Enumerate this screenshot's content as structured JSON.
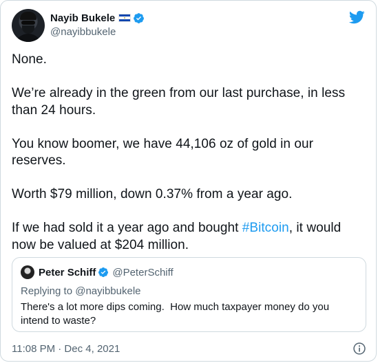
{
  "author": {
    "display_name": "Nayib Bukele",
    "handle": "@nayibbukele",
    "flag_icon": "el-salvador-flag-icon",
    "verified_icon": "verified-badge-icon"
  },
  "brand": {
    "logo_icon": "twitter-bird-icon",
    "accent_color": "#1d9bf0"
  },
  "tweet": {
    "p1": "None.",
    "p2": "We’re already in the green from our last purchase, in less than 24 hours.",
    "p3": "You know boomer, we have 44,106 oz of gold in our reserves.",
    "p4": "Worth $79 million, down 0.37% from a year ago.",
    "p5_before": "If we had sold it a year ago and bought ",
    "p5_hashtag": "#Bitcoin",
    "p5_after": ", it would now be valued at $204 million."
  },
  "quoted_tweet": {
    "display_name": "Peter Schiff",
    "handle": "@PeterSchiff",
    "replying_to": "Replying to @nayibbukele",
    "text": "There's a lot more dips coming.  How much taxpayer money do you intend to waste?"
  },
  "footer": {
    "timestamp": "11:08 PM · Dec 4, 2021",
    "info_icon": "info-icon"
  }
}
